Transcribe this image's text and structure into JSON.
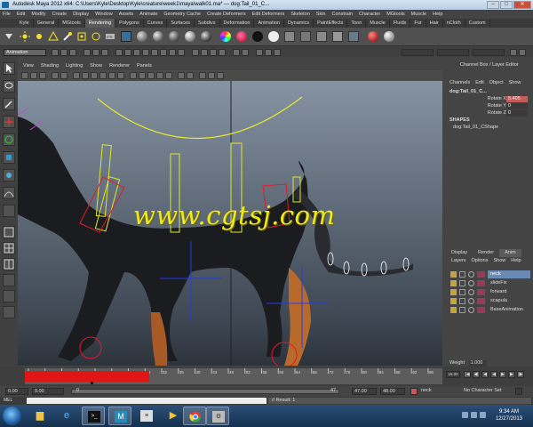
{
  "window": {
    "title": "Autodesk Maya 2012 x64: C:\\Users\\Kyle\\Desktop\\Kyle\\creature\\week1\\maya\\walk01.ma* --- dog:Tail_01_C...",
    "controls": [
      "–",
      "□",
      "✕"
    ]
  },
  "menubar": [
    "File",
    "Edit",
    "Modify",
    "Create",
    "Display",
    "Window",
    "Assets",
    "Animate",
    "Geometry Cache",
    "Create Deformers",
    "Edit Deformers",
    "Skeleton",
    "Skin",
    "Constrain",
    "Character",
    "MGtools",
    "Muscle",
    "Help"
  ],
  "shelf_tabs": [
    {
      "label": "Kyle",
      "active": false
    },
    {
      "label": "General",
      "active": false
    },
    {
      "label": "MGtools",
      "active": false
    },
    {
      "label": "Rendering",
      "active": true
    },
    {
      "label": "Polygons",
      "active": false
    },
    {
      "label": "Curves",
      "active": false
    },
    {
      "label": "Surfaces",
      "active": false
    },
    {
      "label": "Subdivs",
      "active": false
    },
    {
      "label": "Deformation",
      "active": false
    },
    {
      "label": "Animation",
      "active": false
    },
    {
      "label": "Dynamics",
      "active": false
    },
    {
      "label": "PaintEffects",
      "active": false
    },
    {
      "label": "Toon",
      "active": false
    },
    {
      "label": "Muscle",
      "active": false
    },
    {
      "label": "Fluids",
      "active": false
    },
    {
      "label": "Fur",
      "active": false
    },
    {
      "label": "Hair",
      "active": false
    },
    {
      "label": "nCloth",
      "active": false
    },
    {
      "label": "Custom",
      "active": false
    }
  ],
  "statusline": {
    "mode": "Animation"
  },
  "panel_menu": [
    "View",
    "Shading",
    "Lighting",
    "Show",
    "Renderer",
    "Panels"
  ],
  "channelbox": {
    "title": "Channel Box / Layer Editor",
    "menu": [
      "Channels",
      "Edit",
      "Object",
      "Show"
    ],
    "node": "dog:Tail_01_C...",
    "channels": [
      {
        "label": "Rotate X",
        "value": "5.405",
        "highlight": true
      },
      {
        "label": "Rotate Y",
        "value": "0",
        "highlight": false
      },
      {
        "label": "Rotate Z",
        "value": "0",
        "highlight": false
      }
    ],
    "shapes_header": "SHAPES",
    "shape": "dog:Tail_01_CShape"
  },
  "layer_editor": {
    "tabs": [
      {
        "label": "Display",
        "active": false
      },
      {
        "label": "Render",
        "active": false
      },
      {
        "label": "Anim",
        "active": true
      }
    ],
    "menu": [
      "Layers",
      "Options",
      "Show",
      "Help"
    ],
    "layers": [
      {
        "name": "neck",
        "selected": true
      },
      {
        "name": "slideFix",
        "selected": false
      },
      {
        "name": "forward",
        "selected": false
      },
      {
        "name": "scapula",
        "selected": false
      },
      {
        "name": "BaseAnimation",
        "selected": false
      }
    ],
    "weight_label": "Weight",
    "weight_value": "1.000"
  },
  "timeslider": {
    "ticks": [
      "1",
      "4",
      "8",
      "12",
      "16",
      "20",
      "24",
      "28",
      "32",
      "36",
      "40",
      "44",
      "48",
      "52",
      "56",
      "60",
      "64",
      "68",
      "72",
      "76",
      "80",
      "84",
      "88",
      "92",
      "96"
    ],
    "current_frame": "16",
    "current_frame_display": "16.00"
  },
  "rangeslider": {
    "start": "0.00",
    "anim_start": "0.00",
    "range_start": "0",
    "range_end": "47",
    "anim_end_a": "47.00",
    "anim_end_b": "48.00",
    "layer": "neck",
    "character": "No Character Set"
  },
  "cmdline": {
    "label": "MEL",
    "result": "// Result: 1"
  },
  "taskbar": {
    "time": "9:34 AM",
    "date": "12/27/2013"
  },
  "viewport": {
    "watermark": "www.cgtsj.com"
  },
  "colors": {
    "timeline_red": "#e01515",
    "watermark_yellow": "#f0ea1c",
    "selected_layer": "#6a8ab4",
    "highlight_channel": "#c45a5a"
  }
}
